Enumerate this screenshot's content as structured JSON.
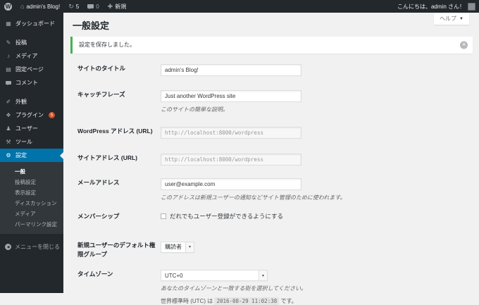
{
  "icons": {
    "logo": "W",
    "home": "⌂",
    "updates": "↻",
    "plus": "✚",
    "caret_down": "▼",
    "select_arrow": "▾",
    "dismiss": "✕",
    "collapse_arrow": "◀",
    "dashboard": "▦",
    "posts": "✎",
    "media": "♪",
    "pages": "▤",
    "appearance": "✐",
    "plugins": "❖",
    "users": "♟",
    "tools": "⚒",
    "settings": "⚙"
  },
  "admin_bar": {
    "site_name": "admin's Blog!",
    "update_count": "5",
    "comment_count": "0",
    "new_label": "新規",
    "greeting": "こんにちは、admin さん！"
  },
  "help_tab": {
    "label": "ヘルプ"
  },
  "sidebar": {
    "items": [
      {
        "label": "ダッシュボード"
      },
      {
        "label": "投稿"
      },
      {
        "label": "メディア"
      },
      {
        "label": "固定ページ"
      },
      {
        "label": "コメント"
      },
      {
        "label": "外観"
      },
      {
        "label": "プラグイン",
        "badge": "5"
      },
      {
        "label": "ユーザー"
      },
      {
        "label": "ツール"
      },
      {
        "label": "設定"
      }
    ],
    "submenu": [
      "一般",
      "投稿設定",
      "表示設定",
      "ディスカッション",
      "メディア",
      "パーマリンク設定"
    ],
    "collapse_label": "メニューを閉じる"
  },
  "main": {
    "title": "一般設定",
    "notice": "設定を保存しました。",
    "site_title": {
      "label": "サイトのタイトル",
      "value": "admin's Blog!"
    },
    "tagline": {
      "label": "キャッチフレーズ",
      "value": "Just another WordPress site",
      "desc": "このサイトの簡単な説明。"
    },
    "wp_url": {
      "label": "WordPress アドレス (URL)",
      "value": "http://localhost:8000/wordpress"
    },
    "site_url": {
      "label": "サイトアドレス (URL)",
      "value": "http://localhost:8000/wordpress"
    },
    "email": {
      "label": "メールアドレス",
      "value": "user@example.com",
      "desc": "このアドレスは新規ユーザーの通知などサイト管理のために使われます。"
    },
    "membership": {
      "label": "メンバーシップ",
      "checkbox_label": "だれでもユーザー登録ができるようにする"
    },
    "default_role": {
      "label": "新規ユーザーのデフォルト権限グループ",
      "value": "購読者"
    },
    "timezone": {
      "label": "タイムゾーン",
      "value": "UTC+0",
      "desc": "あなたのタイムゾーンと一致する街を選択してください。",
      "utc_prefix": "世界標準時 (UTC) は",
      "utc_time": "2016-08-29 11:02:38",
      "utc_suffix": "です。"
    }
  }
}
